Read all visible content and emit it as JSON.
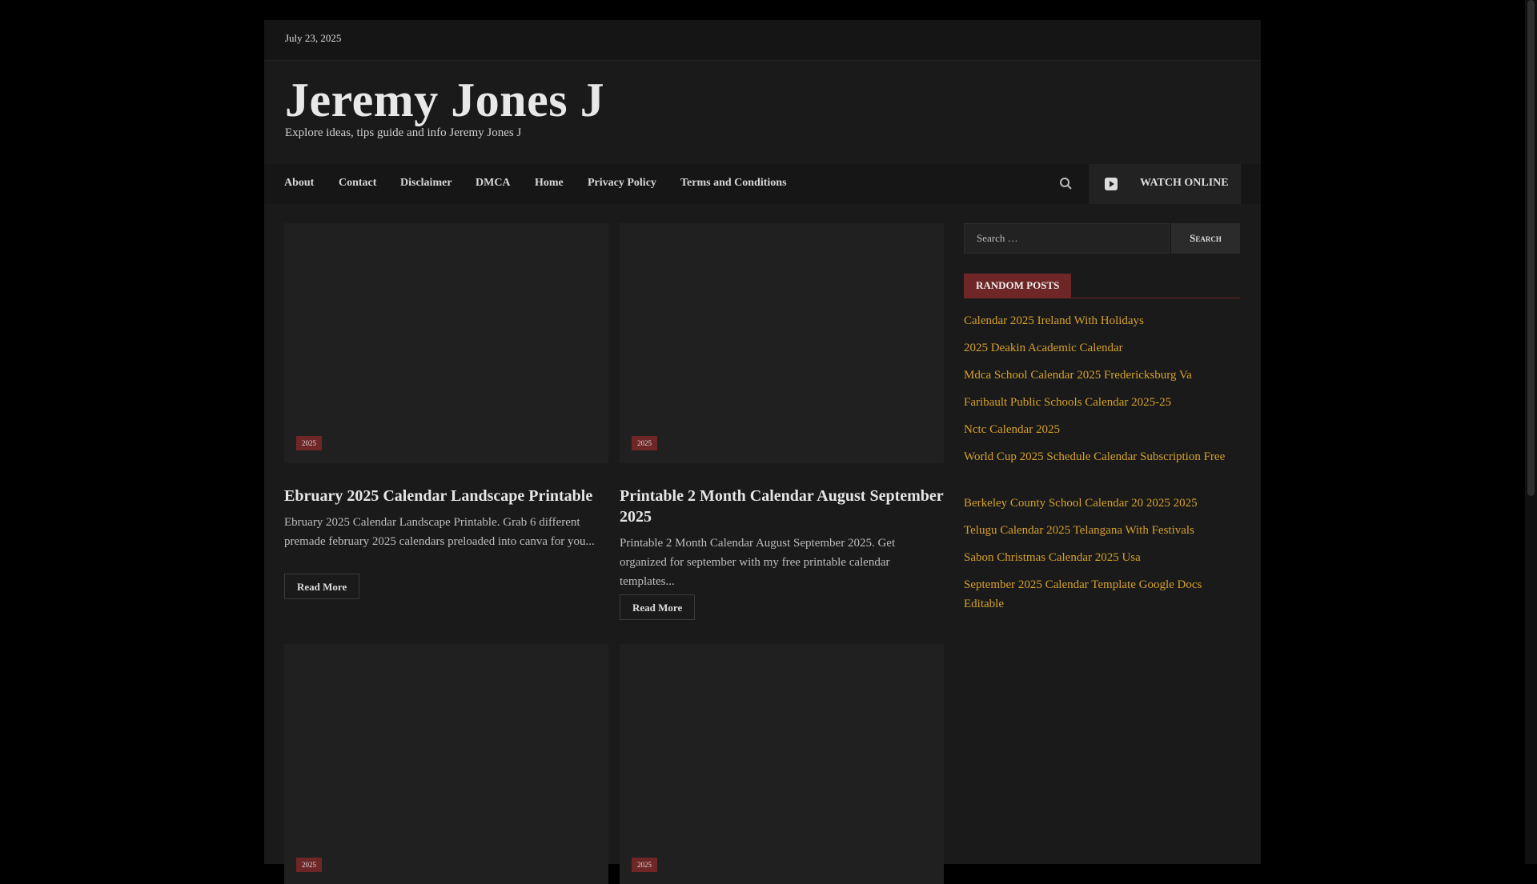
{
  "topbar": {
    "date": "July 23, 2025"
  },
  "site": {
    "title": "Jeremy Jones J",
    "tagline": "Explore ideas, tips guide and info Jeremy Jones J"
  },
  "nav": {
    "items": [
      "About",
      "Contact",
      "Disclaimer",
      "DMCA",
      "Home",
      "Privacy Policy",
      "Terms and Conditions"
    ],
    "watch_label": "WATCH ONLINE",
    "icons": {
      "search": "search-icon",
      "watch": "play-icon"
    }
  },
  "posts": [
    {
      "badge": "2025",
      "title": "Ebruary 2025 Calendar Landscape Printable",
      "excerpt": "Ebruary 2025 Calendar Landscape Printable. Grab 6 different premade february 2025 calendars preloaded into canva for you...",
      "read_more": "Read More"
    },
    {
      "badge": "2025",
      "title": "Printable 2 Month Calendar August September 2025",
      "excerpt": "Printable 2 Month Calendar August September 2025. Get organized for september with my free printable calendar templates...",
      "read_more": "Read More"
    },
    {
      "badge": "2025"
    },
    {
      "badge": "2025"
    }
  ],
  "sidebar": {
    "search_placeholder": "Search …",
    "search_button": "Search",
    "widget_title": "RANDOM POSTS",
    "random_posts": [
      "Calendar 2025 Ireland With Holidays",
      "2025 Deakin Academic Calendar",
      "Mdca School Calendar 2025 Fredericksburg Va",
      "Faribault Public Schools Calendar 2025-25",
      "Nctc Calendar 2025",
      "World Cup 2025 Schedule Calendar Subscription Free",
      "Berkeley County School Calendar 20 2025 2025",
      "Telugu Calendar 2025 Telangana With Festivals",
      "Sabon Christmas Calendar 2025 Usa",
      "September 2025 Calendar Template Google Docs Editable"
    ]
  },
  "colors": {
    "accent": "#6e2626",
    "link": "#d4a02a",
    "background": "#000000",
    "panel": "#1a1a1a"
  }
}
